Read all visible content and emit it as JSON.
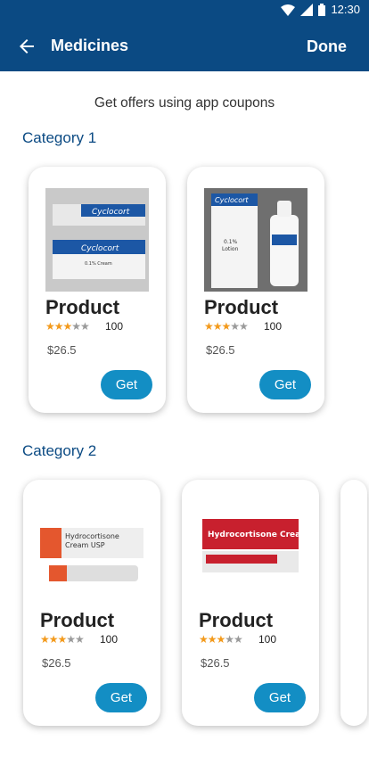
{
  "status": {
    "time": "12:30"
  },
  "header": {
    "title": "Medicines",
    "done_label": "Done"
  },
  "banner": {
    "text": "Get offers using app coupons"
  },
  "categories": [
    {
      "label": "Category 1",
      "products": [
        {
          "name": "Product",
          "rating": 3,
          "reviews": "100",
          "price": "$26.5",
          "action": "Get",
          "image": "Cyclocort"
        },
        {
          "name": "Product",
          "rating": 3,
          "reviews": "100",
          "price": "$26.5",
          "action": "Get",
          "image": "Cyclocort Lotion"
        }
      ]
    },
    {
      "label": "Category 2",
      "products": [
        {
          "name": "Product",
          "rating": 3,
          "reviews": "100",
          "price": "$26.5",
          "action": "Get",
          "image": "Hydrocortisone Cream USP"
        },
        {
          "name": "Product",
          "rating": 3,
          "reviews": "100",
          "price": "$26.5",
          "action": "Get",
          "image": "Hydrocortisone Cream"
        }
      ]
    }
  ],
  "colors": {
    "primary": "#0b4a83",
    "accent": "#138ec4",
    "star": "#f39a1c"
  }
}
